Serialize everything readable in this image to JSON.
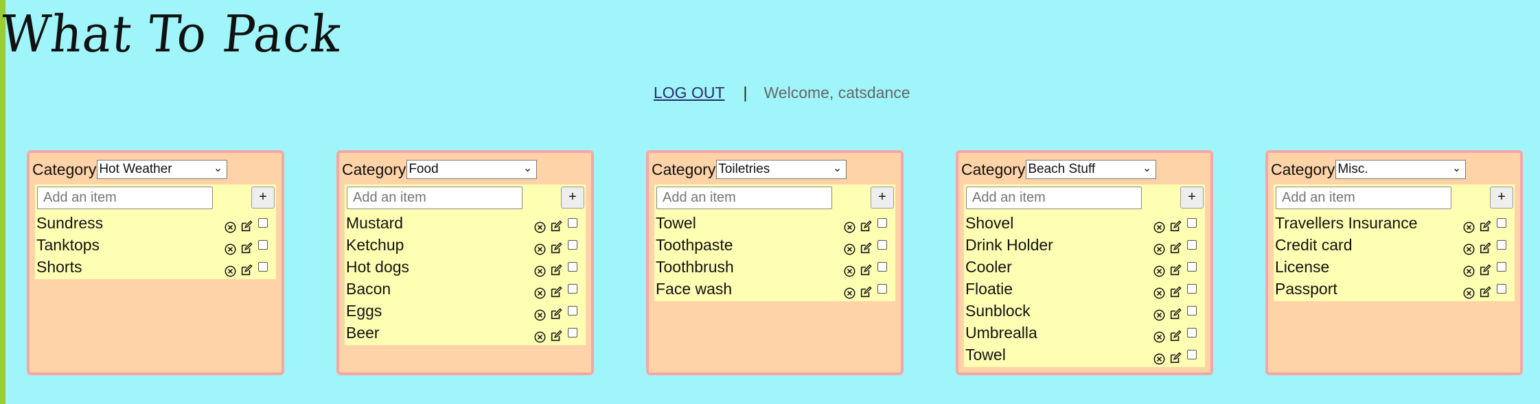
{
  "app": {
    "title": "What To Pack"
  },
  "nav": {
    "logout": "LOG OUT",
    "separator": "|",
    "welcome": "Welcome, catsdance"
  },
  "colors": {
    "page_bg": "#9ff5fa",
    "card_bg": "#ffd3a8",
    "card_border": "#f7a6a6",
    "list_bg": "#ffffb3",
    "left_bar": "#9acd32"
  },
  "icons": {
    "delete": "circle-x-icon",
    "edit": "edit-icon"
  },
  "cards": [
    {
      "category_label": "Category",
      "category_value": "Hot Weather",
      "add_placeholder": "Add an item",
      "add_button": "+",
      "items": [
        "Sundress",
        "Tanktops",
        "Shorts"
      ]
    },
    {
      "category_label": "Category",
      "category_value": "Food",
      "add_placeholder": "Add an item",
      "add_button": "+",
      "items": [
        "Mustard",
        "Ketchup",
        "Hot dogs",
        "Bacon",
        "Eggs",
        "Beer"
      ]
    },
    {
      "category_label": "Category",
      "category_value": "Toiletries",
      "add_placeholder": "Add an item",
      "add_button": "+",
      "items": [
        "Towel",
        "Toothpaste",
        "Toothbrush",
        "Face wash"
      ]
    },
    {
      "category_label": "Category",
      "category_value": "Beach Stuff",
      "add_placeholder": "Add an item",
      "add_button": "+",
      "items": [
        "Shovel",
        "Drink Holder",
        "Cooler",
        "Floatie",
        "Sunblock",
        "Umbrealla",
        "Towel"
      ]
    },
    {
      "category_label": "Category",
      "category_value": "Misc.",
      "add_placeholder": "Add an item",
      "add_button": "+",
      "items": [
        "Travellers Insurance",
        "Credit card",
        "License",
        "Passport"
      ]
    }
  ]
}
